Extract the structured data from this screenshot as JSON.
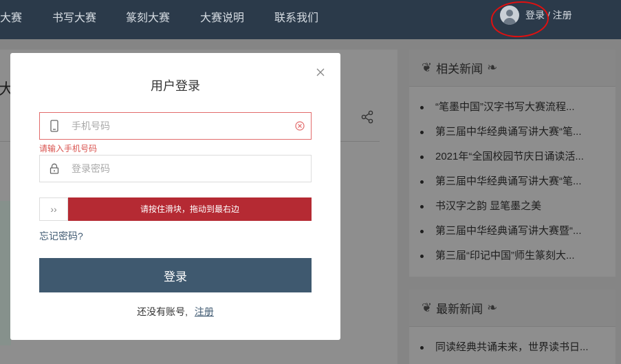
{
  "nav": {
    "items": [
      "大赛",
      "书写大赛",
      "篆刻大赛",
      "大赛说明",
      "联系我们"
    ],
    "login": "登录",
    "separator": "/",
    "register": "注册"
  },
  "main": {
    "title": "大"
  },
  "sidebar": {
    "related_title": "相关新闻",
    "related_items": [
      "“笔墨中国”汉字书写大赛流程...",
      "第三届中华经典诵写讲大赛“笔...",
      "2021年“全国校园节庆日诵读活...",
      "第三届中华经典诵写讲大赛“笔...",
      "书汉字之韵 显笔墨之美",
      "第三届中华经典诵写讲大赛暨“...",
      "第三届“印记中国”师生篆刻大..."
    ],
    "latest_title": "最新新闻",
    "latest_items": [
      "同读经典共诵未来，世界读书日..."
    ]
  },
  "modal": {
    "title": "用户登录",
    "phone_placeholder": "手机号码",
    "phone_error": "请输入手机号码",
    "password_placeholder": "登录密码",
    "slider_text": "请按住滑块，拖动到最右边",
    "slider_handle": "››",
    "forgot": "忘记密码?",
    "login_button": "登录",
    "no_account": "还没有账号,",
    "register_link": "注册"
  },
  "colors": {
    "topbar": "#2b3a4a",
    "primary": "#3f596f",
    "slider": "#b52a33",
    "error": "#d9534f"
  }
}
